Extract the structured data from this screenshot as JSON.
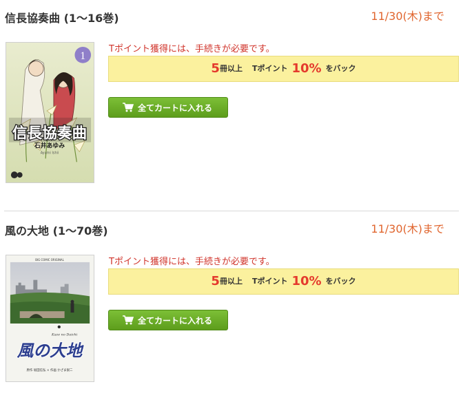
{
  "items": [
    {
      "title": "信長協奏曲 (1〜16巻)",
      "deadline": "11/30(木)まで",
      "cover": {
        "volume_badge": "1",
        "series_logo": "信長協奏曲",
        "author": "石井あゆみ",
        "author_romaji": "Ayumi Ishii"
      },
      "notice": "Tポイント獲得には、手続きが必要です。",
      "campaign": {
        "count": "5",
        "count_suffix": "冊以上",
        "point_label": "Tポイント",
        "rate": "10%",
        "suffix": "をバック"
      },
      "cart_button": "全てカートに入れる"
    },
    {
      "title": "風の大地 (1〜70巻)",
      "deadline": "11/30(木)まで",
      "cover": {
        "imprint": "BIG COMIC ORIGINAL",
        "series_logo": "風の大地",
        "series_romaji": "Kaze no Daichi",
        "author": "原作 坂田信弘 × 作画 かざま鋭二"
      },
      "notice": "Tポイント獲得には、手続きが必要です。",
      "campaign": {
        "count": "5",
        "count_suffix": "冊以上",
        "point_label": "Tポイント",
        "rate": "10%",
        "suffix": "をバック"
      },
      "cart_button": "全てカートに入れる"
    }
  ],
  "colors": {
    "deadline": "#e0652e",
    "notice": "#d0342b",
    "campaign_bg": "#fbf19e",
    "campaign_highlight": "#e43a2d",
    "cart_button": "#6aad28"
  }
}
